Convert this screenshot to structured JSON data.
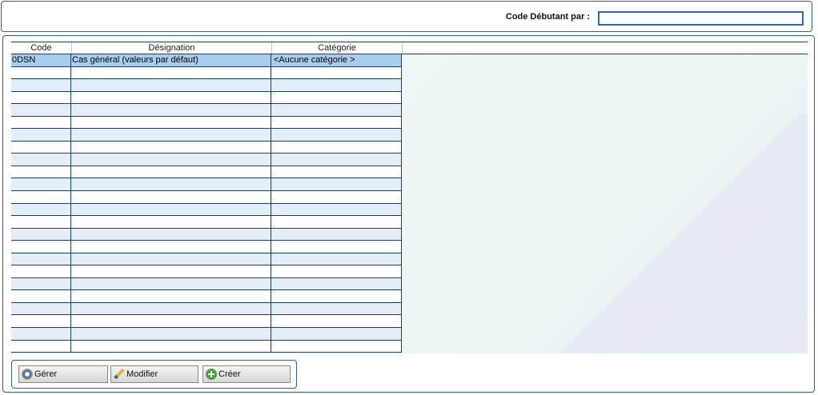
{
  "filter": {
    "label": "Code Débutant par :",
    "value": ""
  },
  "table": {
    "headers": [
      "Code",
      "Désignation",
      "Catégorie"
    ],
    "rows": [
      {
        "code": "0DSN",
        "designation": "Cas général (valeurs par défaut)",
        "categorie": "<Aucune catégorie >",
        "selected": true
      }
    ],
    "empty_rows": 23
  },
  "buttons": {
    "gerer": {
      "label": "Gérer",
      "icon": "gear-icon"
    },
    "modifier": {
      "label": "Modifier",
      "icon": "pencil-icon"
    },
    "creer": {
      "label": "Créer",
      "icon": "plus-circle-icon"
    }
  },
  "colors": {
    "border": "#2f5f8a",
    "selected_row": "#a9cdef",
    "alt_row": "#e4eef8"
  }
}
